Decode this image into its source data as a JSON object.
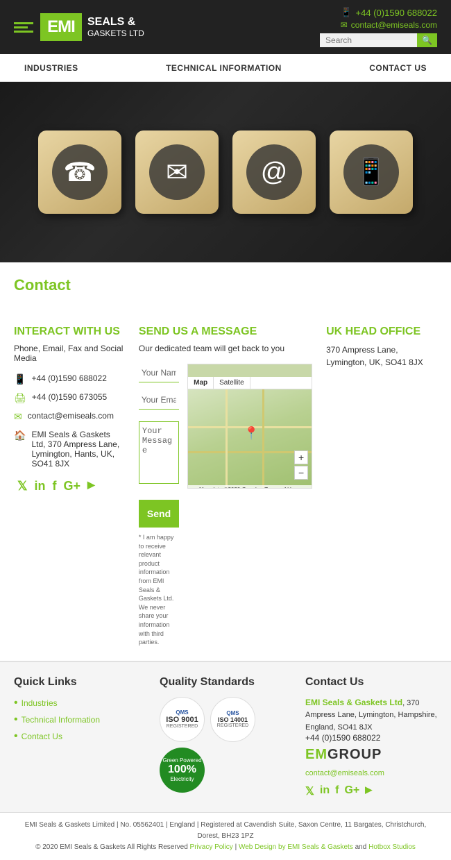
{
  "header": {
    "logo_brand": "EMI",
    "logo_line1": "SEALS &",
    "logo_line2": "GASKETS LTD",
    "phone": "+44 (0)1590 688022",
    "email": "contact@emiseals.com",
    "search_placeholder": "Search"
  },
  "nav": {
    "items": [
      {
        "label": "INDUSTRIES",
        "href": "#"
      },
      {
        "label": "TECHNICAL INFORMATION",
        "href": "#"
      },
      {
        "label": "CONTACT US",
        "href": "#"
      }
    ]
  },
  "page": {
    "title": "Contact"
  },
  "interact": {
    "heading": "INTERACT WITH US",
    "subtext": "Phone, Email, Fax and Social Media",
    "phone1": "+44 (0)1590 688022",
    "phone2": "+44 (0)1590 673055",
    "email": "contact@emiseals.com",
    "address": "EMI Seals & Gaskets Ltd, 370 Ampress Lane, Lymington, Hants, UK, SO41 8JX",
    "social": [
      "twitter",
      "linkedin",
      "facebook",
      "google-plus",
      "youtube"
    ]
  },
  "form": {
    "heading": "SEND US A MESSAGE",
    "subtext": "Our dedicated team will get back to you",
    "name_placeholder": "Your Name*",
    "email_placeholder": "Your Email*",
    "message_placeholder": "Your Message",
    "send_label": "Send",
    "disclaimer": "* I am happy to receive relevant product information from EMI Seals & Gaskets Ltd. We never share your information with third parties."
  },
  "ukoffice": {
    "heading": "UK HEAD OFFICE",
    "address": "370 Ampress Lane, Lymington, UK, SO41 8JX"
  },
  "footer": {
    "quicklinks": {
      "heading": "Quick Links",
      "items": [
        {
          "label": "Industries"
        },
        {
          "label": "Technical Information"
        },
        {
          "label": "Contact Us"
        }
      ]
    },
    "quality": {
      "heading": "Quality Standards",
      "badges": [
        {
          "standard": "ISO9001:2015",
          "code": "ISO 9001",
          "tag": "REGISTERED"
        },
        {
          "standard": "ISO14001:2015",
          "code": "ISO 14001",
          "tag": "REGISTERED"
        },
        {
          "label": "Green Powered",
          "pct": "100%",
          "sub": "Electricity"
        }
      ]
    },
    "contact": {
      "heading": "Contact Us",
      "company_link": "EMI Seals & Gaskets Ltd",
      "address": ", 370 Ampress Lane, Lymington, Hampshire, England, SO41 8JX",
      "phone": "+44 (0)1590 688022",
      "email": "contact@emiseals.com",
      "logo_text": "EMGROUP"
    }
  },
  "footer_bottom": {
    "line1": "EMI Seals & Gaskets Limited | No. 05562401 | England | Registered at Cavendish Suite, Saxon Centre, 11 Bargates, Christchurch, Dorest, BH23 1PZ",
    "line2": "© 2020 EMI Seals & Gaskets All Rights Reserved",
    "privacy": "Privacy Policy",
    "webdesign": "Web Design by EMI Seals & Gaskets",
    "partner": "Hotbox Studios"
  }
}
